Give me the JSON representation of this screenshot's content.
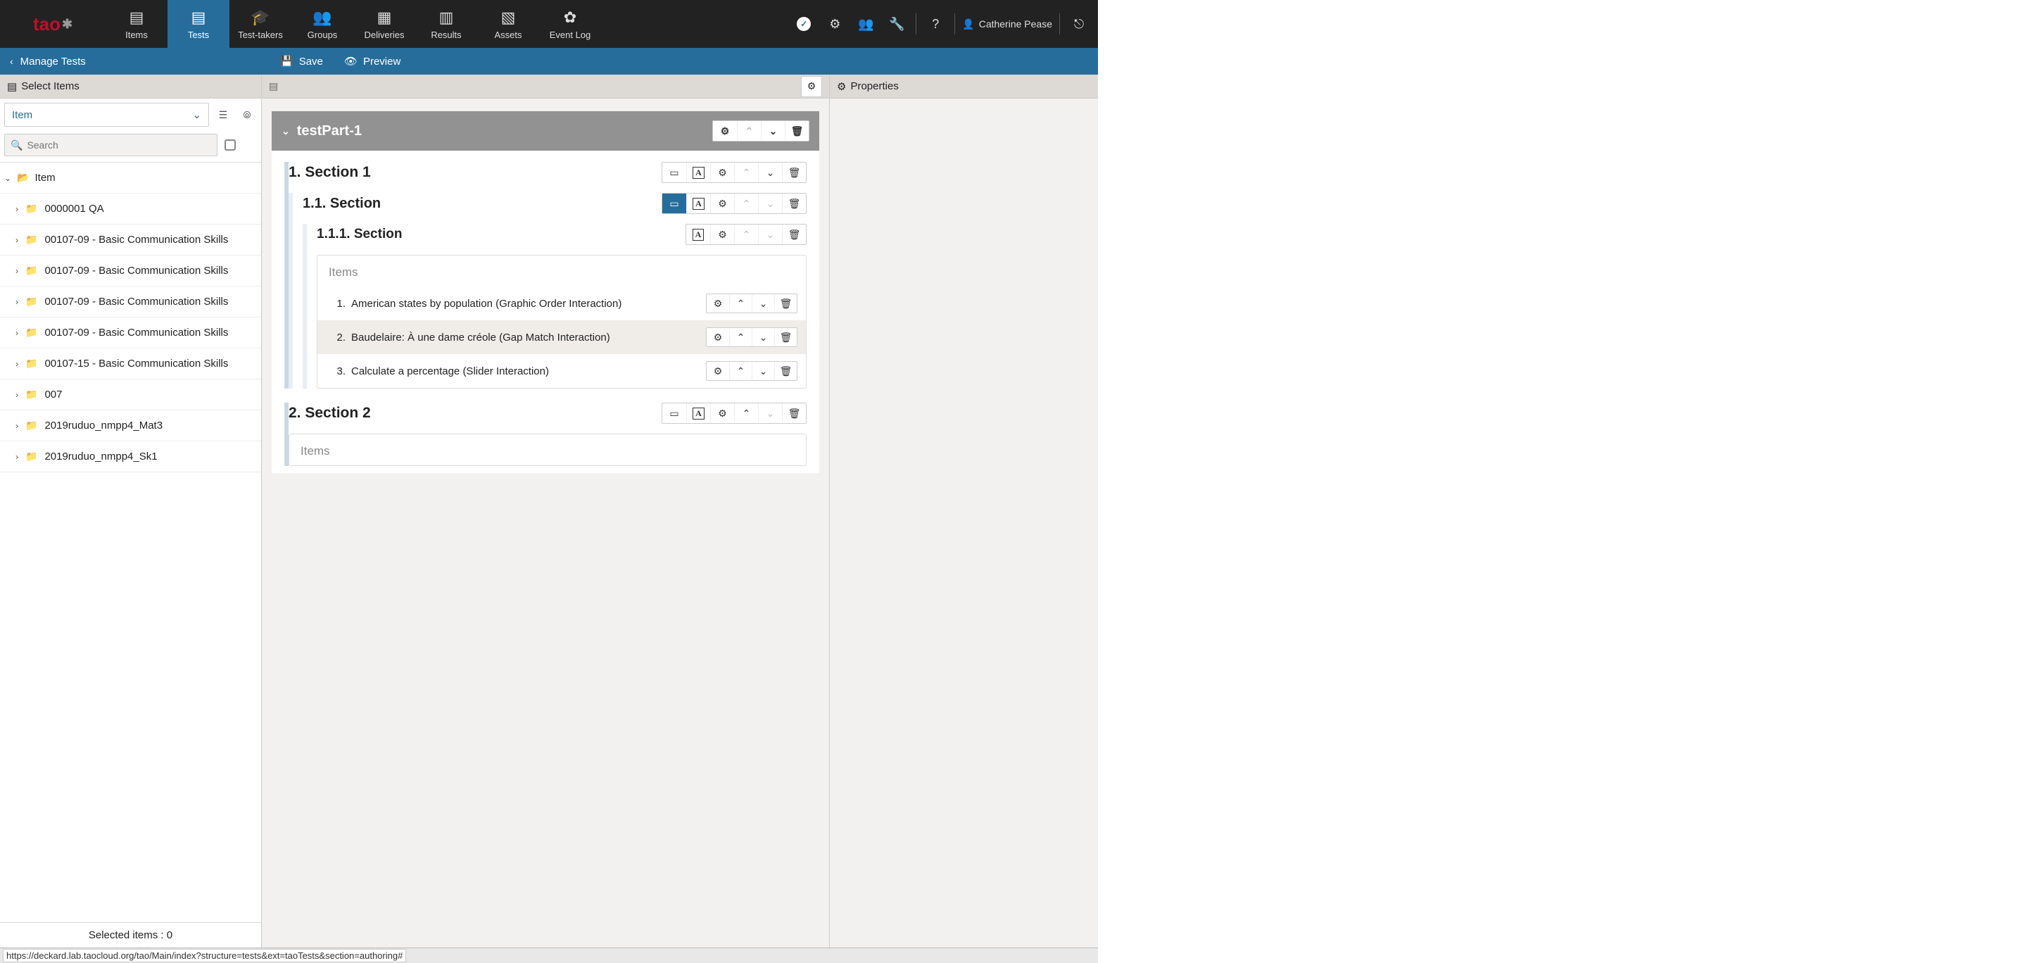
{
  "nav": {
    "tabs": [
      {
        "label": "Items"
      },
      {
        "label": "Tests"
      },
      {
        "label": "Test-takers"
      },
      {
        "label": "Groups"
      },
      {
        "label": "Deliveries"
      },
      {
        "label": "Results"
      },
      {
        "label": "Assets"
      },
      {
        "label": "Event Log"
      }
    ],
    "user": "Catherine Pease"
  },
  "subbar": {
    "back": "Manage Tests",
    "save": "Save",
    "preview": "Preview"
  },
  "left": {
    "title": "Select Items",
    "select": "Item",
    "search_placeholder": "Search",
    "root": "Item",
    "folders": [
      "0000001 QA",
      "00107-09 - Basic Communication Skills",
      "00107-09 - Basic Communication Skills",
      "00107-09 - Basic Communication Skills",
      "00107-09 - Basic Communication Skills",
      "00107-15 - Basic Communication Skills",
      "007",
      "2019ruduo_nmpp4_Mat3",
      "2019ruduo_nmpp4_Sk1"
    ],
    "footer": "Selected items : 0"
  },
  "test": {
    "part": "testPart-1",
    "s1": "1. Section 1",
    "s11": "1.1. Section",
    "s111": "1.1.1. Section",
    "s2": "2. Section 2",
    "items_label": "Items",
    "items": [
      {
        "num": "1.",
        "label": "American states by population (Graphic Order Interaction)"
      },
      {
        "num": "2.",
        "label": "Baudelaire: À une dame créole (Gap Match Interaction)"
      },
      {
        "num": "3.",
        "label": "Calculate a percentage (Slider Interaction)"
      }
    ]
  },
  "right": {
    "title": "Properties"
  },
  "status": "https://deckard.lab.taocloud.org/tao/Main/index?structure=tests&ext=taoTests&section=authoring#"
}
